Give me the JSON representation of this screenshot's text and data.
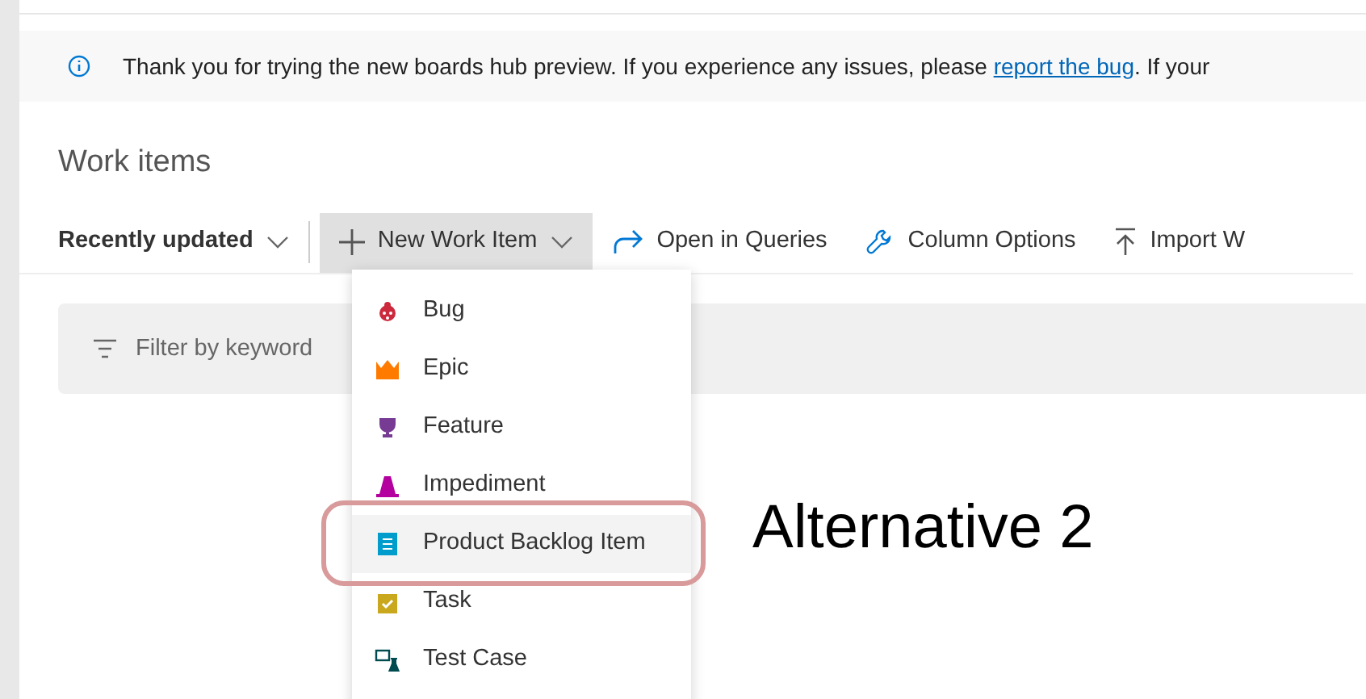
{
  "banner": {
    "text_before": "Thank you for trying the new boards hub preview. If you experience any issues, please ",
    "link": "report the bug",
    "text_after": ". If your"
  },
  "page_title": "Work items",
  "toolbar": [
    {
      "kind": "dropdown",
      "label": "Recently updated",
      "selected": false
    },
    {
      "kind": "new",
      "label": "New Work Item",
      "selected": true
    },
    {
      "kind": "queries",
      "label": "Open in Queries",
      "selected": false
    },
    {
      "kind": "columns",
      "label": "Column Options",
      "selected": false
    },
    {
      "kind": "import",
      "label": "Import W",
      "selected": false
    }
  ],
  "filter": {
    "placeholder": "Filter by keyword"
  },
  "menu": [
    {
      "kind": "bug",
      "label": "Bug",
      "selected": false
    },
    {
      "kind": "epic",
      "label": "Epic",
      "selected": false
    },
    {
      "kind": "feature",
      "label": "Feature",
      "selected": false
    },
    {
      "kind": "impediment",
      "label": "Impediment",
      "selected": false
    },
    {
      "kind": "pbi",
      "label": "Product Backlog Item",
      "selected": true
    },
    {
      "kind": "task",
      "label": "Task",
      "selected": false
    },
    {
      "kind": "testcase",
      "label": "Test Case",
      "selected": false
    }
  ],
  "annotation": {
    "text": "Alternative 2"
  }
}
